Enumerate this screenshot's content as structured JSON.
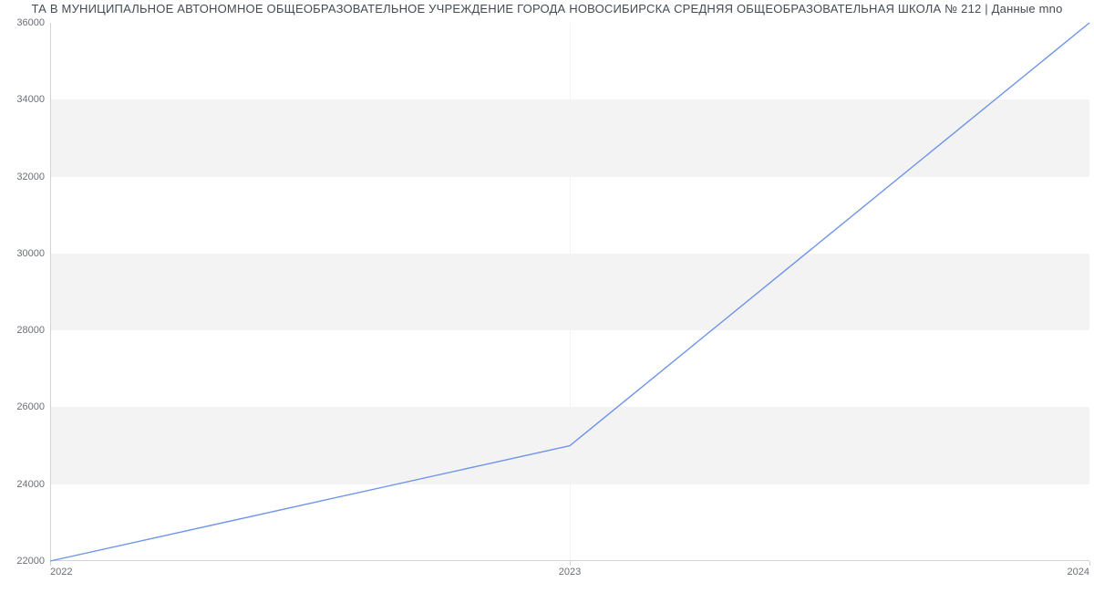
{
  "title": "ТА В МУНИЦИПАЛЬНОЕ АВТОНОМНОЕ ОБЩЕОБРАЗОВАТЕЛЬНОЕ УЧРЕЖДЕНИЕ ГОРОДА НОВОСИБИРСКА СРЕДНЯЯ ОБЩЕОБРАЗОВАТЕЛЬНАЯ ШКОЛА № 212 | Данные mno",
  "chart_data": {
    "type": "line",
    "x": [
      "2022",
      "2023",
      "2024"
    ],
    "values": [
      22000,
      25000,
      36000
    ],
    "y_ticks": [
      22000,
      24000,
      26000,
      28000,
      30000,
      32000,
      34000,
      36000
    ],
    "ylim": [
      22000,
      36000
    ],
    "xlabel": "",
    "ylabel": "",
    "line_color": "#6f94e9"
  }
}
